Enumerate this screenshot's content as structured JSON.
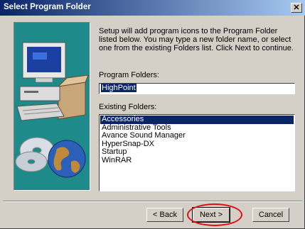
{
  "window": {
    "title": "Select Program Folder",
    "close_glyph": "✕"
  },
  "intro_text": "Setup will add program icons to the Program Folder listed below. You may type a new folder name, or select one from the existing Folders list.  Click Next to continue.",
  "program_folders": {
    "label": "Program Folders:",
    "value": "HighPoint"
  },
  "existing_folders": {
    "label": "Existing Folders:",
    "items": [
      "Accessories",
      "Administrative Tools",
      "Avance Sound Manager",
      "HyperSnap-DX",
      "Startup",
      "WinRAR"
    ],
    "selected_index": 0
  },
  "buttons": {
    "back": "< Back",
    "next": "Next >",
    "cancel": "Cancel"
  },
  "colors": {
    "titlebar": "#0a246a",
    "art_bg": "#1e8a8a",
    "highlight": "#e01010"
  },
  "icons": [
    "computer-illustration-icon",
    "cd-disc-icon",
    "globe-icon",
    "close-icon"
  ]
}
